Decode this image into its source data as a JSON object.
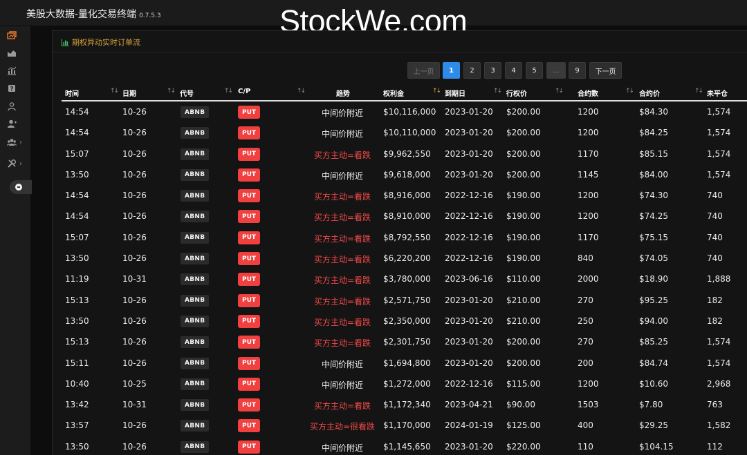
{
  "app": {
    "title": "美股大数据-量化交易终端",
    "version": "0.7.5.3",
    "watermark": "StockWe.com"
  },
  "sidebar": {
    "items": [
      {
        "icon": "trade-icon",
        "active": true,
        "has_submenu": false
      },
      {
        "icon": "chart-flow-icon",
        "active": false,
        "has_submenu": false
      },
      {
        "icon": "bar-chart-icon",
        "active": false,
        "has_submenu": false
      },
      {
        "icon": "help-icon",
        "active": false,
        "has_submenu": false
      },
      {
        "icon": "user-icon",
        "active": false,
        "has_submenu": false
      },
      {
        "icon": "user-add-icon",
        "active": false,
        "has_submenu": false
      },
      {
        "icon": "group-icon",
        "active": false,
        "has_submenu": true
      },
      {
        "icon": "tools-icon",
        "active": false,
        "has_submenu": true
      }
    ]
  },
  "panel": {
    "title": "期权异动实时订单流"
  },
  "pagination": {
    "prev_label": "上一页",
    "pages": [
      "1",
      "2",
      "3",
      "4",
      "5",
      "...",
      "9"
    ],
    "current_page": "1",
    "next_label": "下一页"
  },
  "table": {
    "columns": [
      "时间",
      "日期",
      "代号",
      "C/P",
      "趋势",
      "权利金",
      "到期日",
      "行权价",
      "合约数",
      "合约价",
      "未平仓"
    ],
    "sorted_column": "权利金",
    "rows": [
      {
        "time": "14:54",
        "date": "10-26",
        "ticker": "ABNB",
        "cp": "PUT",
        "trend": "中间价附近",
        "trend_type": "neutral",
        "premium": "$10,116,000",
        "expiry": "2023-01-20",
        "strike": "$200.00",
        "contracts": "1200",
        "price": "$84.30",
        "oi": "1,574"
      },
      {
        "time": "14:54",
        "date": "10-26",
        "ticker": "ABNB",
        "cp": "PUT",
        "trend": "中间价附近",
        "trend_type": "neutral",
        "premium": "$10,110,000",
        "expiry": "2023-01-20",
        "strike": "$200.00",
        "contracts": "1200",
        "price": "$84.25",
        "oi": "1,574"
      },
      {
        "time": "15:07",
        "date": "10-26",
        "ticker": "ABNB",
        "cp": "PUT",
        "trend": "买方主动=看跌",
        "trend_type": "bear",
        "premium": "$9,962,550",
        "expiry": "2023-01-20",
        "strike": "$200.00",
        "contracts": "1170",
        "price": "$85.15",
        "oi": "1,574"
      },
      {
        "time": "13:50",
        "date": "10-26",
        "ticker": "ABNB",
        "cp": "PUT",
        "trend": "中间价附近",
        "trend_type": "neutral",
        "premium": "$9,618,000",
        "expiry": "2023-01-20",
        "strike": "$200.00",
        "contracts": "1145",
        "price": "$84.00",
        "oi": "1,574"
      },
      {
        "time": "14:54",
        "date": "10-26",
        "ticker": "ABNB",
        "cp": "PUT",
        "trend": "买方主动=看跌",
        "trend_type": "bear",
        "premium": "$8,916,000",
        "expiry": "2022-12-16",
        "strike": "$190.00",
        "contracts": "1200",
        "price": "$74.30",
        "oi": "740"
      },
      {
        "time": "14:54",
        "date": "10-26",
        "ticker": "ABNB",
        "cp": "PUT",
        "trend": "买方主动=看跌",
        "trend_type": "bear",
        "premium": "$8,910,000",
        "expiry": "2022-12-16",
        "strike": "$190.00",
        "contracts": "1200",
        "price": "$74.25",
        "oi": "740"
      },
      {
        "time": "15:07",
        "date": "10-26",
        "ticker": "ABNB",
        "cp": "PUT",
        "trend": "买方主动=看跌",
        "trend_type": "bear",
        "premium": "$8,792,550",
        "expiry": "2022-12-16",
        "strike": "$190.00",
        "contracts": "1170",
        "price": "$75.15",
        "oi": "740"
      },
      {
        "time": "13:50",
        "date": "10-26",
        "ticker": "ABNB",
        "cp": "PUT",
        "trend": "买方主动=看跌",
        "trend_type": "bear",
        "premium": "$6,220,200",
        "expiry": "2022-12-16",
        "strike": "$190.00",
        "contracts": "840",
        "price": "$74.05",
        "oi": "740"
      },
      {
        "time": "11:19",
        "date": "10-31",
        "ticker": "ABNB",
        "cp": "PUT",
        "trend": "买方主动=看跌",
        "trend_type": "bear",
        "premium": "$3,780,000",
        "expiry": "2023-06-16",
        "strike": "$110.00",
        "contracts": "2000",
        "price": "$18.90",
        "oi": "1,888"
      },
      {
        "time": "15:13",
        "date": "10-26",
        "ticker": "ABNB",
        "cp": "PUT",
        "trend": "买方主动=看跌",
        "trend_type": "bear",
        "premium": "$2,571,750",
        "expiry": "2023-01-20",
        "strike": "$210.00",
        "contracts": "270",
        "price": "$95.25",
        "oi": "182"
      },
      {
        "time": "13:50",
        "date": "10-26",
        "ticker": "ABNB",
        "cp": "PUT",
        "trend": "买方主动=看跌",
        "trend_type": "bear",
        "premium": "$2,350,000",
        "expiry": "2023-01-20",
        "strike": "$210.00",
        "contracts": "250",
        "price": "$94.00",
        "oi": "182"
      },
      {
        "time": "15:13",
        "date": "10-26",
        "ticker": "ABNB",
        "cp": "PUT",
        "trend": "买方主动=看跌",
        "trend_type": "bear",
        "premium": "$2,301,750",
        "expiry": "2023-01-20",
        "strike": "$200.00",
        "contracts": "270",
        "price": "$85.25",
        "oi": "1,574"
      },
      {
        "time": "15:11",
        "date": "10-26",
        "ticker": "ABNB",
        "cp": "PUT",
        "trend": "中间价附近",
        "trend_type": "neutral",
        "premium": "$1,694,800",
        "expiry": "2023-01-20",
        "strike": "$200.00",
        "contracts": "200",
        "price": "$84.74",
        "oi": "1,574"
      },
      {
        "time": "10:40",
        "date": "10-25",
        "ticker": "ABNB",
        "cp": "PUT",
        "trend": "中间价附近",
        "trend_type": "neutral",
        "premium": "$1,272,000",
        "expiry": "2022-12-16",
        "strike": "$115.00",
        "contracts": "1200",
        "price": "$10.60",
        "oi": "2,968"
      },
      {
        "time": "13:42",
        "date": "10-31",
        "ticker": "ABNB",
        "cp": "PUT",
        "trend": "买方主动=看跌",
        "trend_type": "bear",
        "premium": "$1,172,340",
        "expiry": "2023-04-21",
        "strike": "$90.00",
        "contracts": "1503",
        "price": "$7.80",
        "oi": "763"
      },
      {
        "time": "13:57",
        "date": "10-26",
        "ticker": "ABNB",
        "cp": "PUT",
        "trend": "买方主动=很看跌",
        "trend_type": "bear",
        "premium": "$1,170,000",
        "expiry": "2024-01-19",
        "strike": "$125.00",
        "contracts": "400",
        "price": "$29.25",
        "oi": "1,582"
      },
      {
        "time": "13:50",
        "date": "10-26",
        "ticker": "ABNB",
        "cp": "PUT",
        "trend": "中间价附近",
        "trend_type": "neutral",
        "premium": "$1,145,650",
        "expiry": "2023-01-20",
        "strike": "$220.00",
        "contracts": "110",
        "price": "$104.15",
        "oi": "112"
      }
    ]
  }
}
